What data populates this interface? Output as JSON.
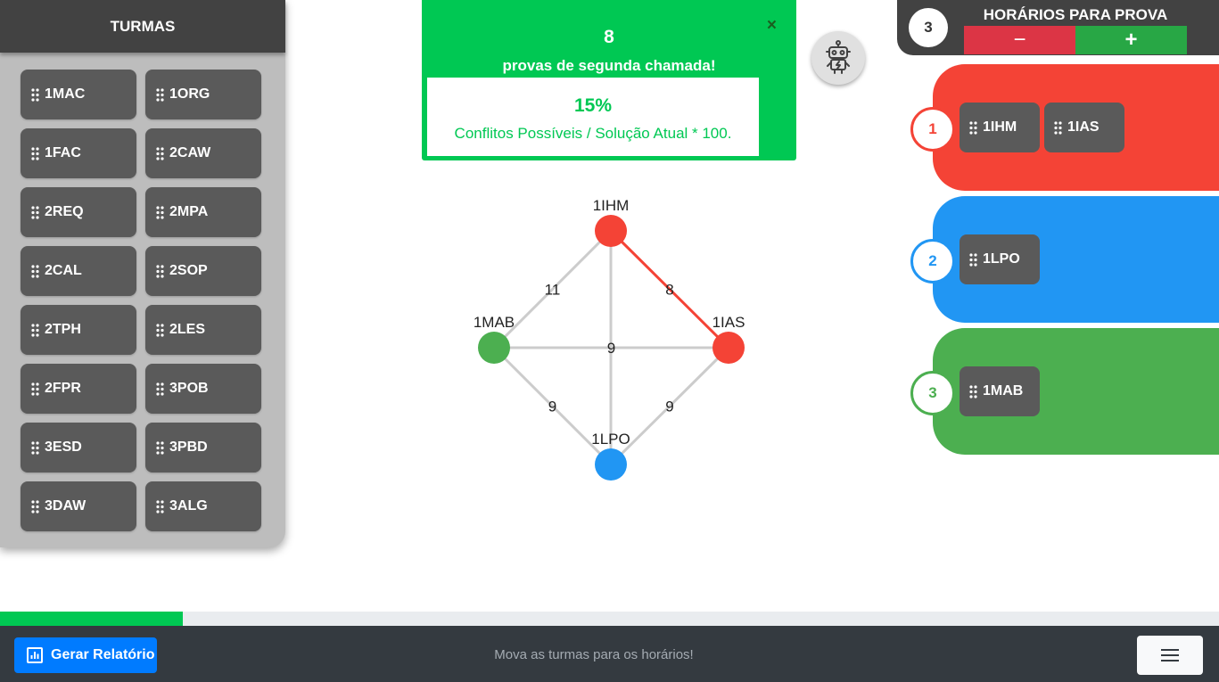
{
  "sidebar": {
    "title": "TURMAS",
    "items": [
      "1MAC",
      "1ORG",
      "1FAC",
      "2CAW",
      "2REQ",
      "2MPA",
      "2CAL",
      "2SOP",
      "2TPH",
      "2LES",
      "2FPR",
      "3POB",
      "3ESD",
      "3PBD",
      "3DAW",
      "3ALG"
    ]
  },
  "info": {
    "count": "8",
    "text": "provas de segunda chamada!",
    "close": "×",
    "percent": "15%",
    "formula": "Conflitos Possíveis / Solução Atual * 100."
  },
  "robot": {
    "icon": "robot-icon"
  },
  "slots": {
    "count": "3",
    "title": "HORÁRIOS PARA PROVA",
    "minus": "−",
    "plus": "+",
    "list": [
      {
        "number": "1",
        "color": "#f44336",
        "items": [
          "1IHM",
          "1IAS"
        ]
      },
      {
        "number": "2",
        "color": "#2196f3",
        "items": [
          "1LPO"
        ]
      },
      {
        "number": "3",
        "color": "#4caf50",
        "items": [
          "1MAB"
        ]
      }
    ]
  },
  "graph": {
    "nodes": [
      {
        "id": "1IHM",
        "label": "1IHM",
        "color": "#f44336"
      },
      {
        "id": "1MAB",
        "label": "1MAB",
        "color": "#4caf50"
      },
      {
        "id": "1IAS",
        "label": "1IAS",
        "color": "#f44336"
      },
      {
        "id": "1LPO",
        "label": "1LPO",
        "color": "#2196f3"
      }
    ],
    "edges": [
      {
        "from": "1IHM",
        "to": "1MAB",
        "label": "11",
        "conflict": false
      },
      {
        "from": "1IHM",
        "to": "1IAS",
        "label": "8",
        "conflict": true
      },
      {
        "from": "1IHM",
        "to": "1LPO",
        "label": "",
        "conflict": false
      },
      {
        "from": "1MAB",
        "to": "1IAS",
        "label": "9",
        "conflict": false
      },
      {
        "from": "1MAB",
        "to": "1LPO",
        "label": "9",
        "conflict": false
      },
      {
        "from": "1IAS",
        "to": "1LPO",
        "label": "9",
        "conflict": false
      }
    ]
  },
  "progress": {
    "value": 0.15
  },
  "footer": {
    "report": "Gerar Relatório",
    "message": "Mova as turmas para os horários!",
    "menu_icon": "hamburger-menu-icon"
  },
  "colors": {
    "success": "#00c853",
    "primary": "#007bff",
    "danger": "#dc3545",
    "dark": "#343a40"
  }
}
